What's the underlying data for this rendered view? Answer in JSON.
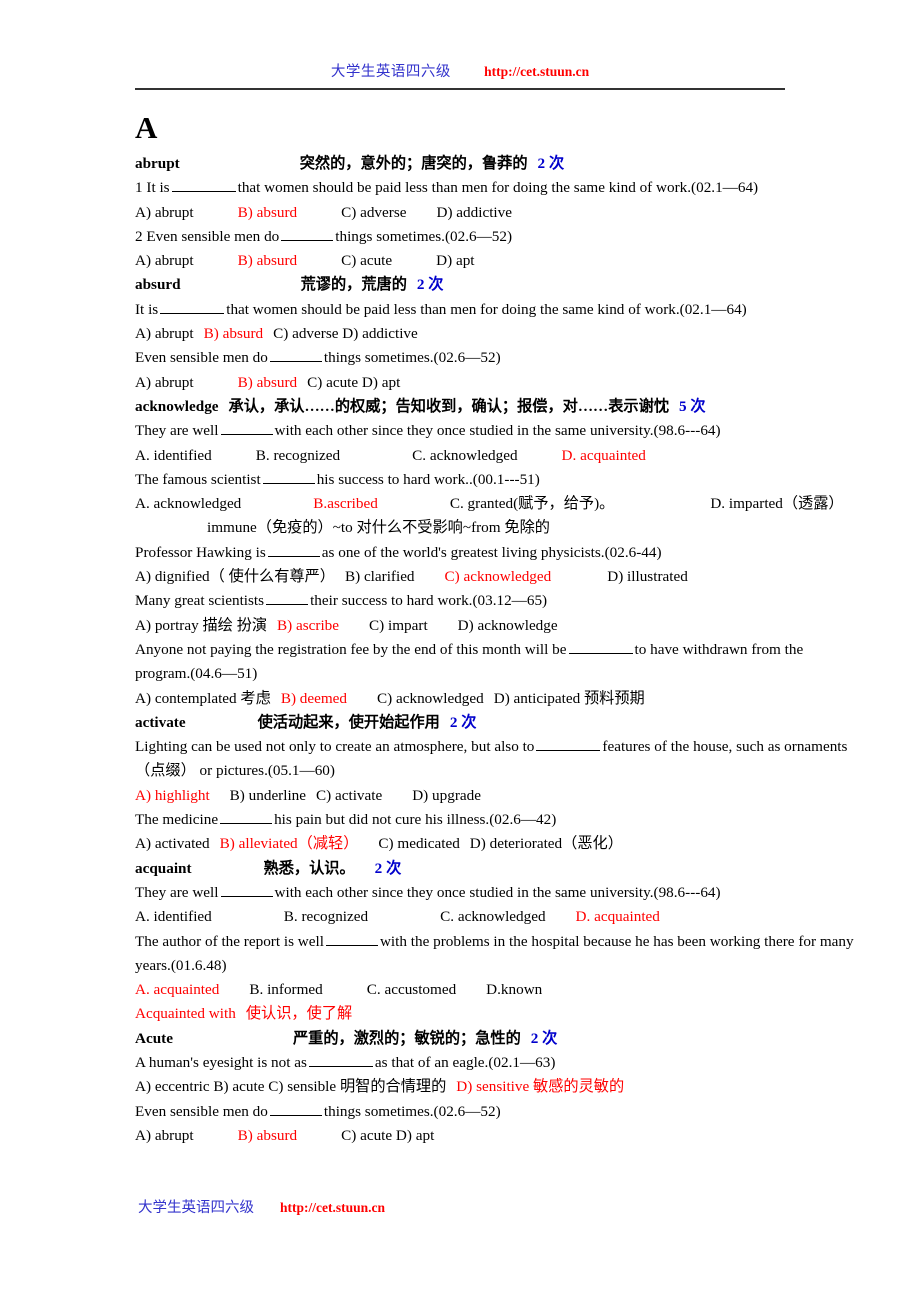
{
  "header": {
    "site_name": "大学生英语四六级",
    "url": "http://cet.stuun.cn"
  },
  "footer": {
    "site_name": "大学生英语四六级",
    "url": "http://cet.stuun.cn"
  },
  "letter_heading": "A",
  "entries": [
    {
      "word": "abrupt",
      "definition": "突然的，意外的；唐突的，鲁莽的",
      "count": "2 次",
      "lines": [
        "1 It is ____ that women should be paid less than men for doing the same kind of work.(02.1—64)",
        "A) abrupt   B) absurd   C) adverse   D) addictive",
        "2 Even sensible men do ____ things sometimes.(02.6—52)",
        "A) abrupt   B) absurd   C) acute   D) apt"
      ]
    },
    {
      "word": "absurd",
      "definition": "荒谬的，荒唐的",
      "count": "2 次",
      "lines": [
        "It is ____ that women should be paid less than men for doing the same kind of work.(02.1—64)",
        "A) abrupt  B) absurd  C) adverse D) addictive",
        "Even sensible men do ____ things sometimes.(02.6—52)",
        "A) abrupt   B) absurd C) acute  D) apt"
      ]
    },
    {
      "word": "acknowledge",
      "definition": "承认，承认……的权威；告知收到，确认；报偿，对……表示谢忱",
      "count": "5 次",
      "lines": [
        "They are well ____ with each other since they once studied in the same university.(98.6---64)",
        "A. identified    B. recognized       C. acknowledged    D. acquainted",
        "The famous scientist ____ his success to hard work..(00.1---51)",
        "A. acknowledged        B.ascribed        C. granted(赋予，给予)。        D. imparted（透露）",
        "immune（免疫的）~to 对什么不受影响~from 免除的",
        "Professor Hawking is ____ as one of the world's greatest living physicists.(02.6-44)",
        "A) dignified（ 使什么有尊严） B) clarified    C) acknowledged       D) illustrated",
        "Many great scientists ____ their success to hard work.(03.12—65)",
        "A) portray 描绘 扮演 B) ascribe    C) impart    D) acknowledge",
        "Anyone not paying the registration fee by the end of this month will be ____to have withdrawn from the program.(04.6—51)",
        "A) contemplated 考虑  B) deemed    C) acknowledged  D) anticipated 预料预期"
      ]
    },
    {
      "word": "activate",
      "definition": "使活动起来，使开始起作用",
      "count": "2 次",
      "lines": [
        "Lighting can be used not only to create an atmosphere, but also to ____ features of the house, such as ornaments（点缀） or pictures.(05.1—60)",
        "A) highlight   B) underline  C) activate    D) upgrade",
        "The medicine ____ his pain but did not cure his illness.(02.6—42)",
        "A) activated   B) alleviated（减轻）   C) medicated  D) deteriorated（恶化）"
      ]
    },
    {
      "word": "acquaint",
      "definition": "熟悉，认识。",
      "count": "2 次",
      "lines": [
        "They are well ____ with each other since they once studied in the same university.(98.6---64)",
        "A. identified       B. recognized        C. acknowledged    D. acquainted",
        "The author of the report is well ____ with the problems in the hospital because he has been working there for many years.(01.6.48)",
        "A. acquainted    B. informed      C. accustomed     D.known",
        "Acquainted with 使认识，使了解"
      ]
    },
    {
      "word": "Acute",
      "definition": "严重的，激烈的；敏锐的；急性的",
      "count": "2 次",
      "lines": [
        "A human's eyesight is not as ____ as that of an eagle.(02.1—63)",
        " A) eccentric B) acute  C) sensible 明智的合情理的 D) sensitive 敏感的灵敏的",
        "Even sensible men do ____ things sometimes.(02.6—52)",
        "A) abrupt     B) absurd     C) acute  D) apt"
      ]
    }
  ],
  "text": {
    "e1_w": "abrupt",
    "e1_def": "突然的，意外的；唐突的，鲁莽的",
    "e1_cnt": "2 次",
    "e1_l1a": "1 It is",
    "e1_l1b": "that women should be paid less than men for doing the same kind of work.(02.1—64)",
    "e1_l2a": "A) abrupt",
    "e1_l2b": "B) absurd",
    "e1_l2c": "C) adverse",
    "e1_l2d": "D) addictive",
    "e1_l3a": "2 Even sensible men do",
    "e1_l3b": "things sometimes.(02.6—52)",
    "e1_l4a": "A) abrupt",
    "e1_l4b": "B) absurd",
    "e1_l4c": "C) acute",
    "e1_l4d": "D) apt",
    "e2_w": "absurd",
    "e2_def": "荒谬的，荒唐的",
    "e2_cnt": "2 次",
    "e2_l1a": "It is",
    "e2_l1b": "that women should be paid less than men for doing the same kind of work.(02.1—64)",
    "e2_l2a": "A) abrupt",
    "e2_l2b": "B) absurd",
    "e2_l2c": "C) adverse D) addictive",
    "e2_l3a": "Even sensible men do",
    "e2_l3b": "things sometimes.(02.6—52)",
    "e2_l4a": "A) abrupt",
    "e2_l4b": "B) absurd",
    "e2_l4c": "C) acute  D) apt",
    "e3_w": "acknowledge",
    "e3_def": "承认，承认……的权威；告知收到，确认；报偿，对……表示谢忱",
    "e3_cnt": "5 次",
    "e3_l1a": "They are well",
    "e3_l1b": "with each other since they once studied in the same university.(98.6---64)",
    "e3_l2a": "A. identified",
    "e3_l2b": "B. recognized",
    "e3_l2c": "C. acknowledged",
    "e3_l2d": "D. acquainted",
    "e3_l3a": "The famous scientist",
    "e3_l3b": "his success to hard work..(00.1---51)",
    "e3_l4a": "A. acknowledged",
    "e3_l4b": "B.ascribed",
    "e3_l4c": "C. granted(赋予，给予)。",
    "e3_l4d": "D. imparted（透露）",
    "e3_l5": "immune（免疫的）~to 对什么不受影响~from 免除的",
    "e3_l6a": "Professor Hawking is",
    "e3_l6b": "as one of the world's greatest living physicists.(02.6-44)",
    "e3_l7a": "A) dignified（ 使什么有尊严）",
    "e3_l7b": "B) clarified",
    "e3_l7c": "C) acknowledged",
    "e3_l7d": "D) illustrated",
    "e3_l8a": "Many great scientists",
    "e3_l8b": "their success to hard work.(03.12—65)",
    "e3_l9a": "A) portray 描绘 扮演",
    "e3_l9b": "B) ascribe",
    "e3_l9c": "C) impart",
    "e3_l9d": "D) acknowledge",
    "e3_l10a": "Anyone not paying the registration fee by the end of this month will be",
    "e3_l10b": "to have withdrawn from the",
    "e3_l11": "program.(04.6—51)",
    "e3_l12a": "A) contemplated 考虑",
    "e3_l12b": "B) deemed",
    "e3_l12c": "C) acknowledged",
    "e3_l12d": "D) anticipated 预料预期",
    "e4_w": "activate",
    "e4_def": "使活动起来，使开始起作用",
    "e4_cnt": "2 次",
    "e4_l1a": "Lighting can be used not only to create an atmosphere, but also to",
    "e4_l1b": "features of the house, such as ornaments",
    "e4_l2": "（点缀） or pictures.(05.1—60)",
    "e4_l3a": "A) highlight",
    "e4_l3b": "B) underline",
    "e4_l3c": "C) activate",
    "e4_l3d": "D) upgrade",
    "e4_l4a": "The medicine",
    "e4_l4b": "his pain but did not cure his illness.(02.6—42)",
    "e4_l5a": "A) activated",
    "e4_l5b": "B) alleviated（减轻）",
    "e4_l5c": "C) medicated",
    "e4_l5d": "D) deteriorated（恶化）",
    "e5_w": "acquaint",
    "e5_def": "熟悉，认识。",
    "e5_cnt": "2 次",
    "e5_l1a": "They are well",
    "e5_l1b": "with each other since they once studied in the same university.(98.6---64)",
    "e5_l2a": "A. identified",
    "e5_l2b": "B. recognized",
    "e5_l2c": "C. acknowledged",
    "e5_l2d": "D. acquainted",
    "e5_l3a": "The author of the report is well",
    "e5_l3b": "with the problems in the hospital because he has been working there for many",
    "e5_l4": "years.(01.6.48)",
    "e5_l5a": "A. acquainted",
    "e5_l5b": "B. informed",
    "e5_l5c": "C. accustomed",
    "e5_l5d": "D.known",
    "e5_l6a": "Acquainted with",
    "e5_l6b": "使认识，使了解",
    "e6_w": "Acute",
    "e6_def": "严重的，激烈的；敏锐的；急性的",
    "e6_cnt": "2 次",
    "e6_l1a": "A human's eyesight is not as",
    "e6_l1b": "as that of an eagle.(02.1—63)",
    "e6_l2a": " A) eccentric B) acute  C) sensible 明智的合情理的",
    "e6_l2b": "D) sensitive 敏感的灵敏的",
    "e6_l3a": "Even sensible men do",
    "e6_l3b": "things sometimes.(02.6—52)",
    "e6_l4a": "A) abrupt",
    "e6_l4b": "B) absurd",
    "e6_l4c": "C) acute  D) apt"
  },
  "colors": {
    "answer_red": "#ff0000",
    "count_blue": "#0000cc",
    "site_blue": "#3333cc"
  }
}
